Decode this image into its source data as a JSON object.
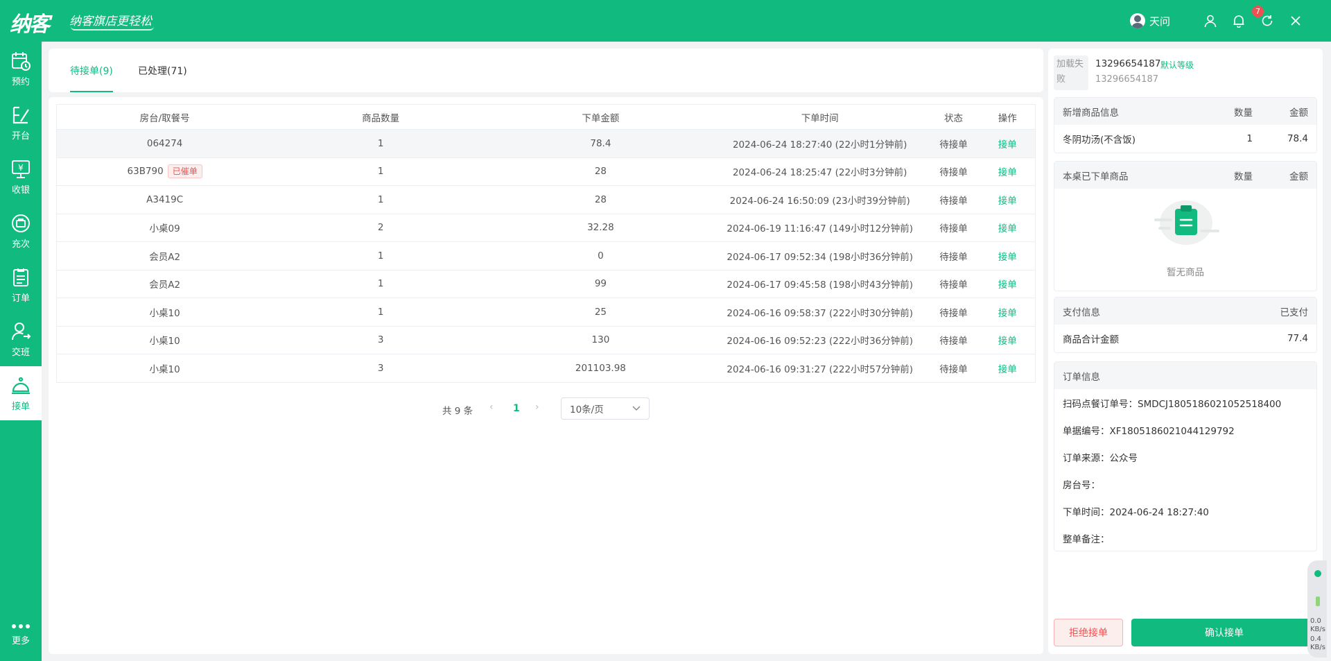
{
  "app": {
    "logo": "纳客",
    "slogan": "纳客旗店更轻松",
    "user_name": "天问",
    "notification_count": "7"
  },
  "sidebar": {
    "items": [
      {
        "label": "预约",
        "icon": "calendar-clock-icon"
      },
      {
        "label": "开台",
        "icon": "open-table-icon"
      },
      {
        "label": "收银",
        "icon": "cashier-icon"
      },
      {
        "label": "充次",
        "icon": "recharge-icon"
      },
      {
        "label": "订单",
        "icon": "order-list-icon"
      },
      {
        "label": "交班",
        "icon": "shift-handover-icon"
      },
      {
        "label": "接单",
        "icon": "service-bell-icon"
      }
    ],
    "more_label": "更多",
    "active": "接单"
  },
  "tabs": [
    {
      "label": "待接单(9)"
    },
    {
      "label": "已处理(71)"
    }
  ],
  "table": {
    "headers": [
      "房台/取餐号",
      "商品数量",
      "下单金额",
      "下单时间",
      "状态",
      "操作"
    ],
    "rows": [
      {
        "table_no": "064274",
        "tag": "",
        "qty": "1",
        "amount": "78.4",
        "time": "2024-06-24 18:27:40 (22小时1分钟前)",
        "status": "待接单",
        "action": "接单"
      },
      {
        "table_no": "63B790",
        "tag": "已催单",
        "qty": "1",
        "amount": "28",
        "time": "2024-06-24 18:25:47 (22小时3分钟前)",
        "status": "待接单",
        "action": "接单"
      },
      {
        "table_no": "A3419C",
        "tag": "",
        "qty": "1",
        "amount": "28",
        "time": "2024-06-24 16:50:09 (23小时39分钟前)",
        "status": "待接单",
        "action": "接单"
      },
      {
        "table_no": "小桌09",
        "tag": "",
        "qty": "2",
        "amount": "32.28",
        "time": "2024-06-19 11:16:47 (149小时12分钟前)",
        "status": "待接单",
        "action": "接单"
      },
      {
        "table_no": "会员A2",
        "tag": "",
        "qty": "1",
        "amount": "0",
        "time": "2024-06-17 09:52:34 (198小时36分钟前)",
        "status": "待接单",
        "action": "接单"
      },
      {
        "table_no": "会员A2",
        "tag": "",
        "qty": "1",
        "amount": "99",
        "time": "2024-06-17 09:45:58 (198小时43分钟前)",
        "status": "待接单",
        "action": "接单"
      },
      {
        "table_no": "小桌10",
        "tag": "",
        "qty": "1",
        "amount": "25",
        "time": "2024-06-16 09:58:37 (222小时30分钟前)",
        "status": "待接单",
        "action": "接单"
      },
      {
        "table_no": "小桌10",
        "tag": "",
        "qty": "3",
        "amount": "130",
        "time": "2024-06-16 09:52:23 (222小时36分钟前)",
        "status": "待接单",
        "action": "接单"
      },
      {
        "table_no": "小桌10",
        "tag": "",
        "qty": "3",
        "amount": "201103.98",
        "time": "2024-06-16 09:31:27 (222小时57分钟前)",
        "status": "待接单",
        "action": "接单"
      }
    ]
  },
  "pagination": {
    "total": "共 9 条",
    "current_page": "1",
    "page_size": "10条/页"
  },
  "detail": {
    "load_failed": "加载失败",
    "phone": "13296654187",
    "level": "默认等级",
    "phone_sub": "13296654187",
    "new_items": {
      "title": "新增商品信息",
      "qty_header": "数量",
      "amount_header": "金额",
      "items": [
        {
          "name": "冬阴功汤(不含饭)",
          "qty": "1",
          "amount": "78.4"
        }
      ]
    },
    "ordered_items": {
      "title": "本桌已下单商品",
      "qty_header": "数量",
      "amount_header": "金额",
      "empty_text": "暂无商品"
    },
    "payment": {
      "title": "支付信息",
      "status": "已支付",
      "total_label": "商品合计金额",
      "total_value": "77.4"
    },
    "order_info": {
      "title": "订单信息",
      "lines": [
        "扫码点餐订单号：SMDCJ1805186021052518400",
        "单据编号：XF1805186021044129792",
        "订单来源：公众号",
        "房台号：",
        "下单时间：2024-06-24 18:27:40",
        "整单备注："
      ]
    },
    "reject_label": "拒绝接单",
    "confirm_label": "确认接单"
  },
  "widget": {
    "line1": "0.0",
    "line2": "KB/s",
    "line3": "0.4",
    "line4": "KB/s"
  },
  "colors": {
    "brand": "#11bb7f",
    "danger": "#f05050"
  }
}
